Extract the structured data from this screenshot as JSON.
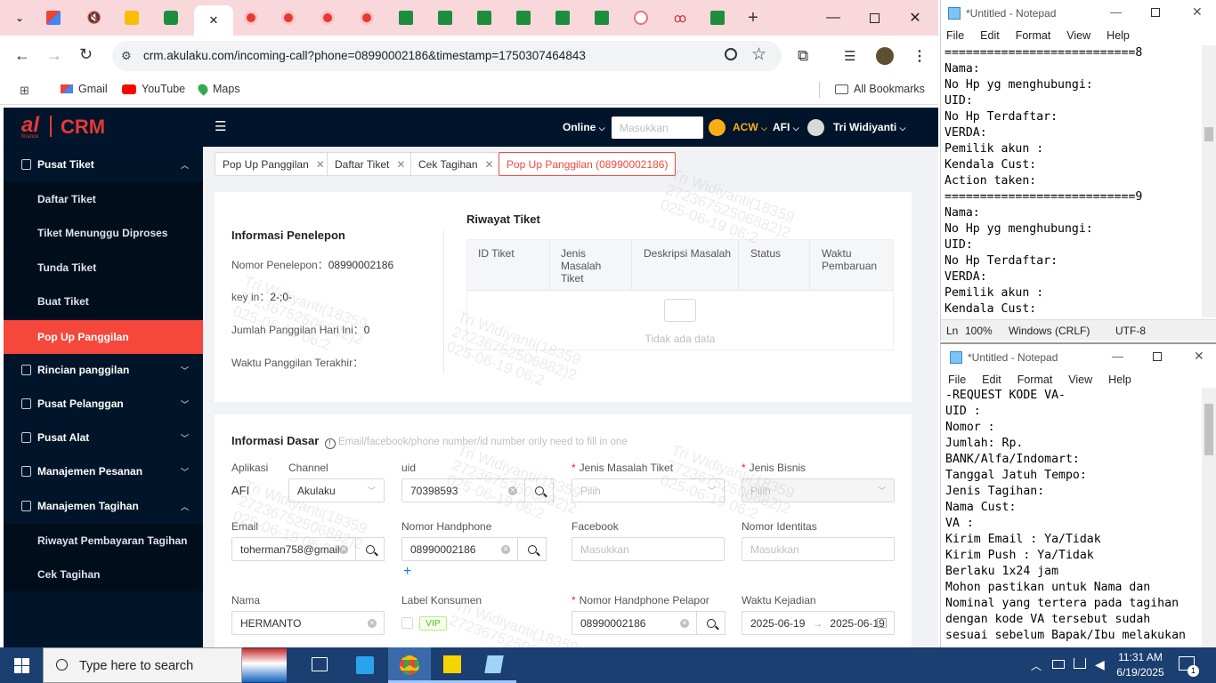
{
  "browser": {
    "url": "crm.akulaku.com/incoming-call?phone=08990002186&timestamp=1750307464843",
    "tab_close": "✕",
    "new_tab": "+",
    "bookmarks": [
      {
        "label": "Gmail"
      },
      {
        "label": "YouTube"
      },
      {
        "label": "Maps"
      }
    ],
    "all_bookmarks": "All Bookmarks"
  },
  "crm": {
    "logo_al": "al",
    "logo_sub": "finance",
    "logo_crm": "CRM",
    "header": {
      "status": "Online",
      "search_placeholder": "Masukkan",
      "acw": "ACW",
      "afi": "AFI",
      "user": "Tri Widiyanti"
    },
    "sidebar": {
      "groups": [
        {
          "label": "Pusat Tiket",
          "expanded": true
        },
        {
          "label": "Rincian panggilan"
        },
        {
          "label": "Pusat Pelanggan"
        },
        {
          "label": "Pusat Alat"
        },
        {
          "label": "Manajemen Pesanan"
        },
        {
          "label": "Manajemen Tagihan",
          "expanded": true
        }
      ],
      "sub_tiket": [
        "Daftar Tiket",
        "Tiket Menunggu Diproses",
        "Tunda Tiket",
        "Buat Tiket",
        "Pop Up Panggilan"
      ],
      "sub_tagihan": [
        "Riwayat Pembayaran Tagihan",
        "Cek Tagihan"
      ]
    },
    "tabs": [
      {
        "label": "Pop Up Panggilan"
      },
      {
        "label": "Daftar Tiket"
      },
      {
        "label": "Cek Tagihan"
      },
      {
        "label": "Pop Up Panggilan (08990002186)",
        "active": true
      }
    ],
    "caller_info": {
      "title": "Informasi Penelepon",
      "phone_label": "Nomor Penelepon：",
      "phone_value": "08990002186",
      "keyin_label": "key in：",
      "keyin_value": "2-;0-",
      "calls_label": "Jumlah Panggilan Hari Ini：",
      "calls_value": "0",
      "last_label": "Waktu Panggilan Terakhir："
    },
    "ticket_history": {
      "title": "Riwayat Tiket",
      "columns": [
        "ID Tiket",
        "Jenis Masalah Tiket",
        "Deskripsi Masalah",
        "Status",
        "Waktu Pembaruan"
      ],
      "empty": "Tidak ada data"
    },
    "basic_info": {
      "title": "Informasi Dasar",
      "hint": "Email/facebook/phone number/id number only need to fill in one",
      "aplikasi_label": "Aplikasi",
      "aplikasi_value": "AFI",
      "channel_label": "Channel",
      "channel_value": "Akulaku",
      "uid_label": "uid",
      "uid_value": "70398593",
      "jenis_masalah_label": "Jenis Masalah Tiket",
      "jenis_masalah_ph": "Pilih",
      "jenis_bisnis_label": "Jenis Bisnis",
      "jenis_bisnis_ph": "Pilih",
      "email_label": "Email",
      "email_value": "toherman758@gmail.",
      "hp_label": "Nomor Handphone",
      "hp_value": "08990002186",
      "add_sign": "+",
      "facebook_label": "Facebook",
      "facebook_ph": "Masukkan",
      "identitas_label": "Nomor Identitas",
      "identitas_ph": "Masukkan",
      "nama_label": "Nama",
      "nama_value": "HERMANTO",
      "label_konsumen": "Label Konsumen",
      "vip": "VIP",
      "hp_pelapor_label": "Nomor Handphone Pelapor",
      "hp_pelapor_value": "08990002186",
      "waktu_label": "Waktu Kejadian",
      "waktu_from": "2025-06-19",
      "waktu_arrow": "→",
      "waktu_to": "2025-06-19"
    },
    "watermark": {
      "name": "Tri Widiyanti(18359",
      "code": "27236752506882)2",
      "date": "025-06-19 06:2"
    }
  },
  "notepad_top": {
    "title": "*Untitled - Notepad",
    "menu": [
      "File",
      "Edit",
      "Format",
      "View",
      "Help"
    ],
    "text": "===========================8\nNama:\nNo Hp yg menghubungi:\nUID:\nNo Hp Terdaftar:\nVERDA:\nPemilik akun :\nKendala Cust:\nAction taken:\n===========================9\nNama:\nNo Hp yg menghubungi:\nUID:\nNo Hp Terdaftar:\nVERDA:\nPemilik akun :\nKendala Cust:",
    "status": {
      "pos": "Ln",
      "zoom": "100%",
      "eol": "Windows (CRLF)",
      "enc": "UTF-8"
    }
  },
  "notepad_bottom": {
    "title": "*Untitled - Notepad",
    "menu": [
      "File",
      "Edit",
      "Format",
      "View",
      "Help"
    ],
    "text": "-REQUEST KODE VA-\nUID :\nNomor :\nJumlah: Rp.\nBANK/Alfa/Indomart:\nTanggal Jatuh Tempo:\nJenis Tagihan:\nNama Cust:\nVA :\nKirim Email : Ya/Tidak\nKirim Push : Ya/Tidak\nBerlaku 1x24 jam\nMohon pastikan untuk Nama dan\nNominal yang tertera pada tagihan\ndengan kode VA tersebut sudah\nsesuai sebelum Bapak/Ibu melakukan"
  },
  "taskbar": {
    "search_placeholder": "Type here to search",
    "time": "11:31 AM",
    "date": "6/19/2025",
    "notification_count": "1"
  },
  "colors": {
    "sidebar_bg": "#001529",
    "active_red": "#f5473c",
    "tab_strip": "#f9d8dc",
    "taskbar": "#1c3f72"
  }
}
